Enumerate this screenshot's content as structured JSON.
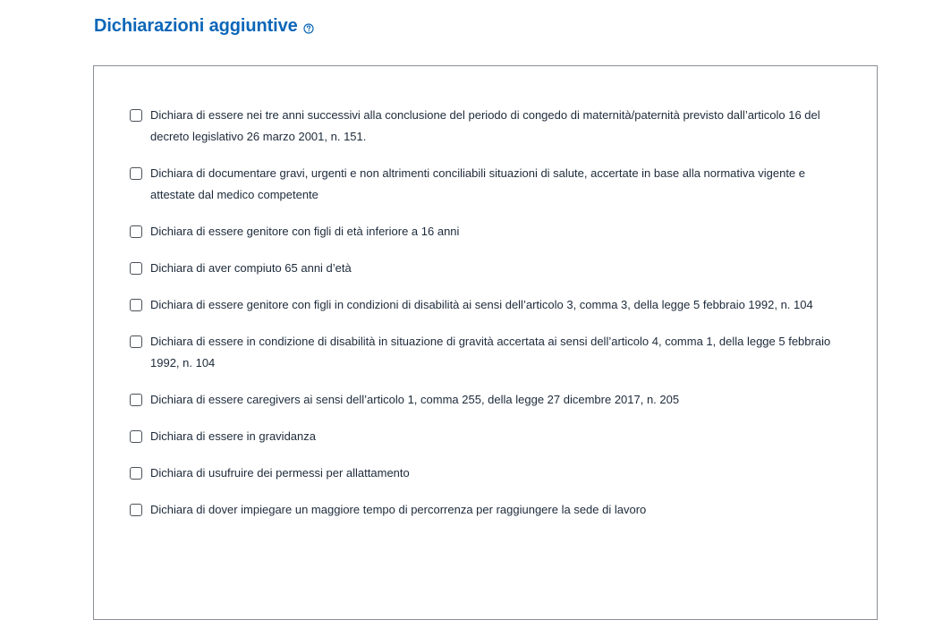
{
  "section": {
    "title": "Dichiarazioni aggiuntive",
    "help_icon": "question-circle-icon",
    "accent_color": "#0b66b8"
  },
  "declarations": [
    {
      "label": "Dichiara di essere nei tre anni successivi alla conclusione del periodo di congedo di maternità/paternità previsto dall’articolo 16 del decreto legislativo 26 marzo 2001, n. 151.",
      "checked": false
    },
    {
      "label": "Dichiara di documentare gravi, urgenti e non altrimenti conciliabili situazioni di salute, accertate in base alla normativa vigente e attestate dal medico competente",
      "checked": false
    },
    {
      "label": "Dichiara di essere genitore con figli di età inferiore a 16 anni",
      "checked": false
    },
    {
      "label": "Dichiara di aver compiuto 65 anni d’età",
      "checked": false
    },
    {
      "label": "Dichiara di essere genitore con figli in condizioni di disabilità ai sensi dell’articolo 3, comma 3, della legge 5 febbraio 1992, n. 104",
      "checked": false
    },
    {
      "label": "Dichiara di essere in condizione di disabilità in situazione di gravità accertata ai sensi dell’articolo 4, comma 1, della legge 5 febbraio 1992, n. 104",
      "checked": false
    },
    {
      "label": "Dichiara di essere caregivers ai sensi dell’articolo 1, comma 255, della legge 27 dicembre 2017, n. 205",
      "checked": false
    },
    {
      "label": "Dichiara di essere in gravidanza",
      "checked": false
    },
    {
      "label": "Dichiara di usufruire dei permessi per allattamento",
      "checked": false
    },
    {
      "label": "Dichiara di dover impiegare un maggiore tempo di percorrenza per raggiungere la sede di lavoro",
      "checked": false
    }
  ]
}
